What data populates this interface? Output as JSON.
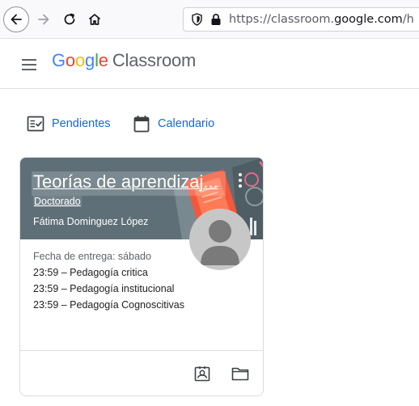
{
  "browser": {
    "url_prefix": "https://classroom.",
    "url_host": "google.com",
    "url_suffix": "/h"
  },
  "header": {
    "logo": {
      "g1": "G",
      "o1": "o",
      "o2": "o",
      "g2": "g",
      "l": "l",
      "e": "e"
    },
    "product": "Classroom"
  },
  "quick_links": {
    "pending": "Pendientes",
    "calendar": "Calendario"
  },
  "class_card": {
    "title": "Teorías de aprendizaj...",
    "section": "Doctorado",
    "teacher": "Fátima Dominguez López",
    "due_label": "Fecha de entrega: sábado",
    "assignments": [
      "23:59 – Pedagogía critica",
      "23:59 – Pedagogía institucional",
      "23:59 – Pedagogía Cognoscitivas"
    ],
    "banner_color": "#5f6f78"
  },
  "colors": {
    "link_blue": "#1967d2",
    "google_blue": "#4285f4",
    "google_red": "#ea4335",
    "google_yellow": "#fbbc04",
    "google_green": "#34a853"
  }
}
